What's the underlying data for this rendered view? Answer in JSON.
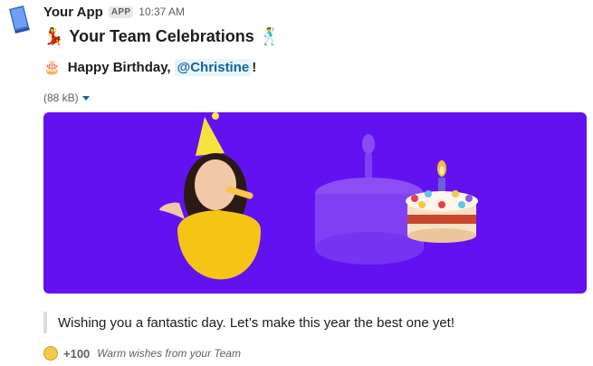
{
  "header": {
    "app_name": "Your App",
    "badge": "APP",
    "time": "10:37 AM"
  },
  "message": {
    "title_text": "Your Team Celebrations",
    "title_emoji_left": "💃",
    "title_emoji_right": "🕺",
    "birthday_emoji": "🎂",
    "birthday_text": "Happy Birthday,",
    "mention": "@Christine",
    "birthday_suffix": "!",
    "file_size": "(88 kB)",
    "quote": "Wishing you a fantastic day. Let’s make this year the best one yet!"
  },
  "footer": {
    "points": "+100",
    "note": "Warm wishes from your Team"
  },
  "colors": {
    "banner_bg": "#6212f0",
    "mention_bg": "#e8f5fa",
    "mention_text": "#1264a3"
  },
  "icons": [
    "app-icon",
    "dancer-woman-icon",
    "dancer-man-icon",
    "birthday-cake-icon",
    "caret-down-icon",
    "coin-icon"
  ]
}
